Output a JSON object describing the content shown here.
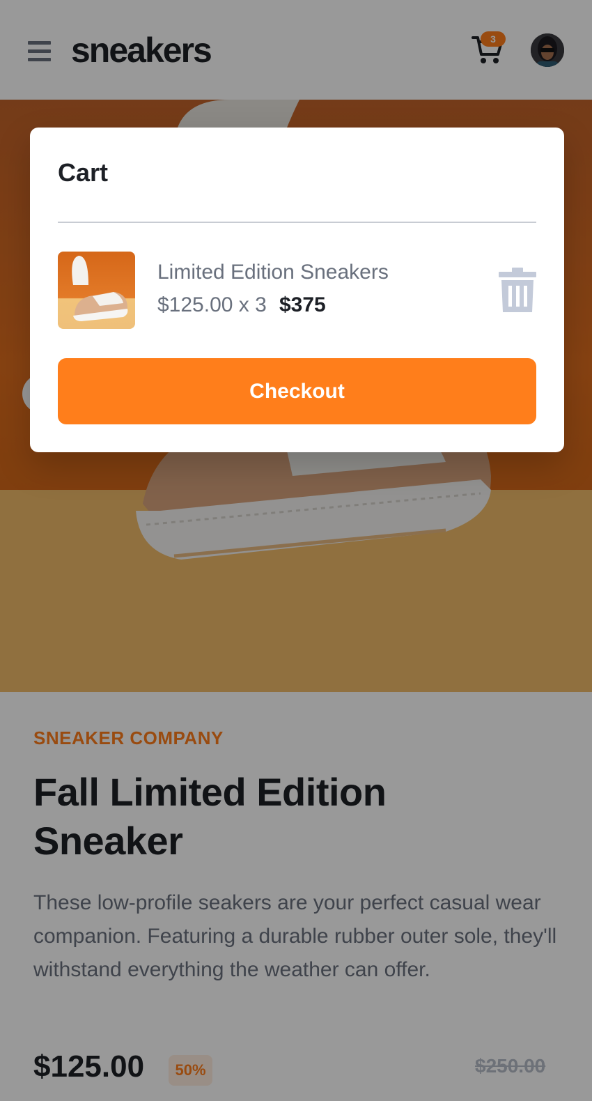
{
  "header": {
    "logo": "sneakers",
    "cart_count": "3"
  },
  "product": {
    "company": "SNEAKER COMPANY",
    "title": "Fall Limited Edition Sneaker",
    "description": "These low-profile seakers are your perfect casual wear companion. Featuring a durable rubber outer sole, they'll withstand everything the weather can offer.",
    "price": "$125.00",
    "discount": "50%",
    "old_price": "$250.00"
  },
  "cart": {
    "title": "Cart",
    "item": {
      "name": "Limited Edition Sneakers",
      "unit_price_qty": "$125.00 x 3",
      "total": "$375"
    },
    "checkout_label": "Checkout"
  },
  "colors": {
    "accent": "#ff7e1b",
    "dark_text": "#1d2026",
    "muted_text": "#69707d"
  },
  "icons": [
    "menu-icon",
    "cart-icon",
    "avatar",
    "trash-icon"
  ]
}
